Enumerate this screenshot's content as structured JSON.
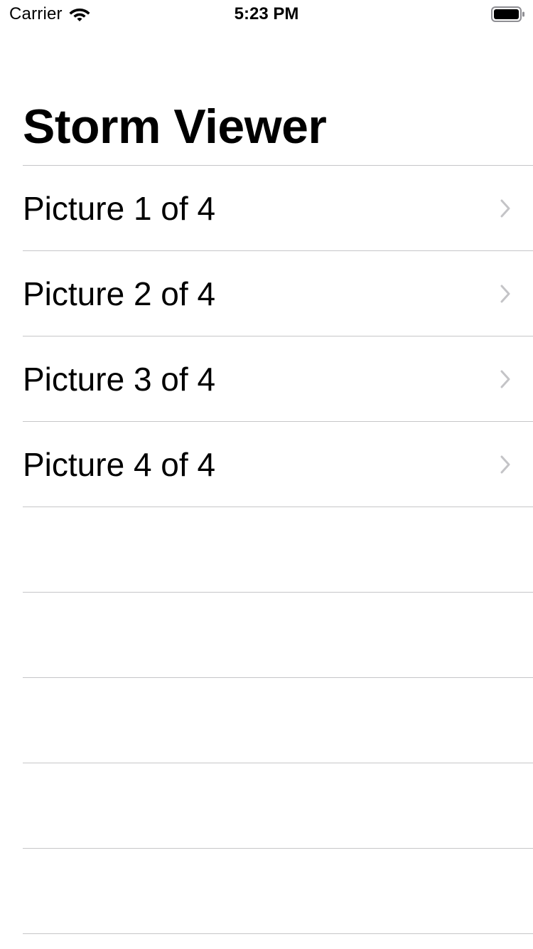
{
  "status_bar": {
    "carrier": "Carrier",
    "time": "5:23 PM",
    "wifi_icon": "wifi-icon",
    "battery_icon": "battery-full-icon"
  },
  "nav": {
    "title": "Storm Viewer"
  },
  "table": {
    "rows": [
      {
        "label": "Picture 1 of 4",
        "accessory": "chevron-right-icon"
      },
      {
        "label": "Picture 2 of 4",
        "accessory": "chevron-right-icon"
      },
      {
        "label": "Picture 3 of 4",
        "accessory": "chevron-right-icon"
      },
      {
        "label": "Picture 4 of 4",
        "accessory": "chevron-right-icon"
      }
    ]
  },
  "colors": {
    "background": "#ffffff",
    "text": "#000000",
    "separator": "#c6c6c8",
    "chevron": "#c4c4c7"
  }
}
